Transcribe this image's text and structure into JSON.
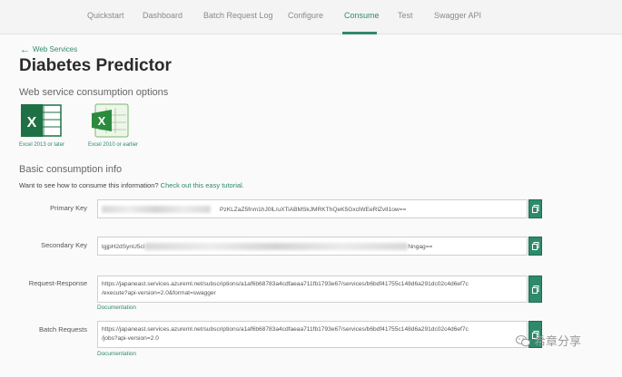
{
  "nav": {
    "tabs": [
      {
        "label": "Quickstart"
      },
      {
        "label": "Dashboard"
      },
      {
        "label": "Batch Request Log"
      },
      {
        "label": "Configure"
      },
      {
        "label": "Consume"
      },
      {
        "label": "Test"
      },
      {
        "label": "Swagger API"
      }
    ],
    "active_tab": "Consume"
  },
  "breadcrumb": {
    "back_label": "Web Services"
  },
  "page": {
    "title": "Diabetes Predictor"
  },
  "consumption_options": {
    "heading": "Web service consumption options",
    "items": [
      {
        "caption": "Excel 2013 or later",
        "icon": "excel-2013-icon"
      },
      {
        "caption": "Excel 2010 or earlier",
        "icon": "excel-2010-icon"
      }
    ]
  },
  "basic_info": {
    "heading": "Basic consumption info",
    "intro_text": "Want to see how to consume this information?",
    "intro_link": "Check out this easy tutorial."
  },
  "fields": {
    "primary_key": {
      "label": "Primary Key",
      "visible_value": "PzKLZaZ5fnm1hJ0lL/uXTiABMSkJMRKThQeK5GxclWEeRlZvlI1ow=="
    },
    "secondary_key": {
      "label": "Secondary Key",
      "prefix": "tgjpH2dSynU5cl",
      "suffix": "Nngag=="
    },
    "request_response": {
      "label": "Request-Response",
      "line1": "https://japaneast.services.azureml.net/subscriptions/a1af6b68783a4cdfaeaa711fb1793e67/services/b6bdf41755c148d6a291dc02c4d6ef7c",
      "line2": "/execute?api-version=2.0&format=swagger",
      "doc_label": "Documentation"
    },
    "batch_requests": {
      "label": "Batch Requests",
      "line1": "https://japaneast.services.azureml.net/subscriptions/a1af6b68783a4cdfaeaa711fb1793e67/services/b6bdf41755c148d6a291dc02c4d6ef7c",
      "line2": "/jobs?api-version=2.0",
      "doc_label": "Documentation"
    }
  },
  "watermark": {
    "text": "希章分享"
  },
  "colors": {
    "accent": "#2f8a6b",
    "excel_green": "#1e7145"
  }
}
